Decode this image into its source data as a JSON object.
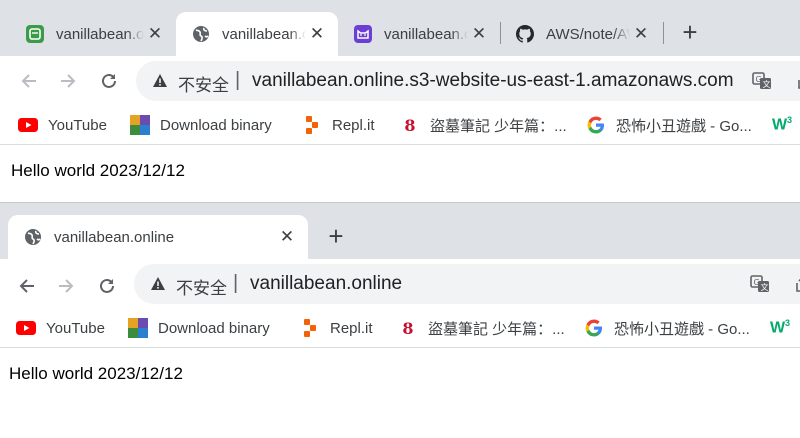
{
  "window1": {
    "tabs": [
      {
        "title": "vanillabean.online",
        "icon": "green-cup-icon",
        "active": false
      },
      {
        "title": "vanillabean.online",
        "icon": "globe-icon",
        "active": true
      },
      {
        "title": "vanillabean.online",
        "icon": "purple-cat-icon",
        "active": false
      },
      {
        "title": "AWS/note/AWS",
        "icon": "github-icon",
        "active": false
      }
    ],
    "security_label": "不安全",
    "url": "vanillabean.online.s3-website-us-east-1.amazonaws.com",
    "page_text": "Hello world 2023/12/12"
  },
  "window2": {
    "tabs": [
      {
        "title": "vanillabean.online",
        "icon": "globe-icon",
        "active": true
      }
    ],
    "security_label": "不安全",
    "url": "vanillabean.online",
    "page_text": "Hello world 2023/12/12"
  },
  "bookmarks": [
    {
      "label": "YouTube",
      "icon": "youtube-icon"
    },
    {
      "label": "Download binary",
      "icon": "colored-blocks-icon"
    },
    {
      "label": "Repl.it",
      "icon": "replit-icon"
    },
    {
      "label": "盜墓筆記 少年篇：...",
      "icon": "red-eight-icon"
    },
    {
      "label": "恐怖小丑遊戲 - Go...",
      "icon": "google-g-icon"
    },
    {
      "label": "",
      "icon": "w3-icon"
    }
  ],
  "colors": {
    "tabstrip": "#dee1e6",
    "omnibox": "#f1f3f4",
    "youtube_red": "#ff0000",
    "green_favicon": "#3b9b49",
    "purple_favicon": "#6b3fd4"
  }
}
